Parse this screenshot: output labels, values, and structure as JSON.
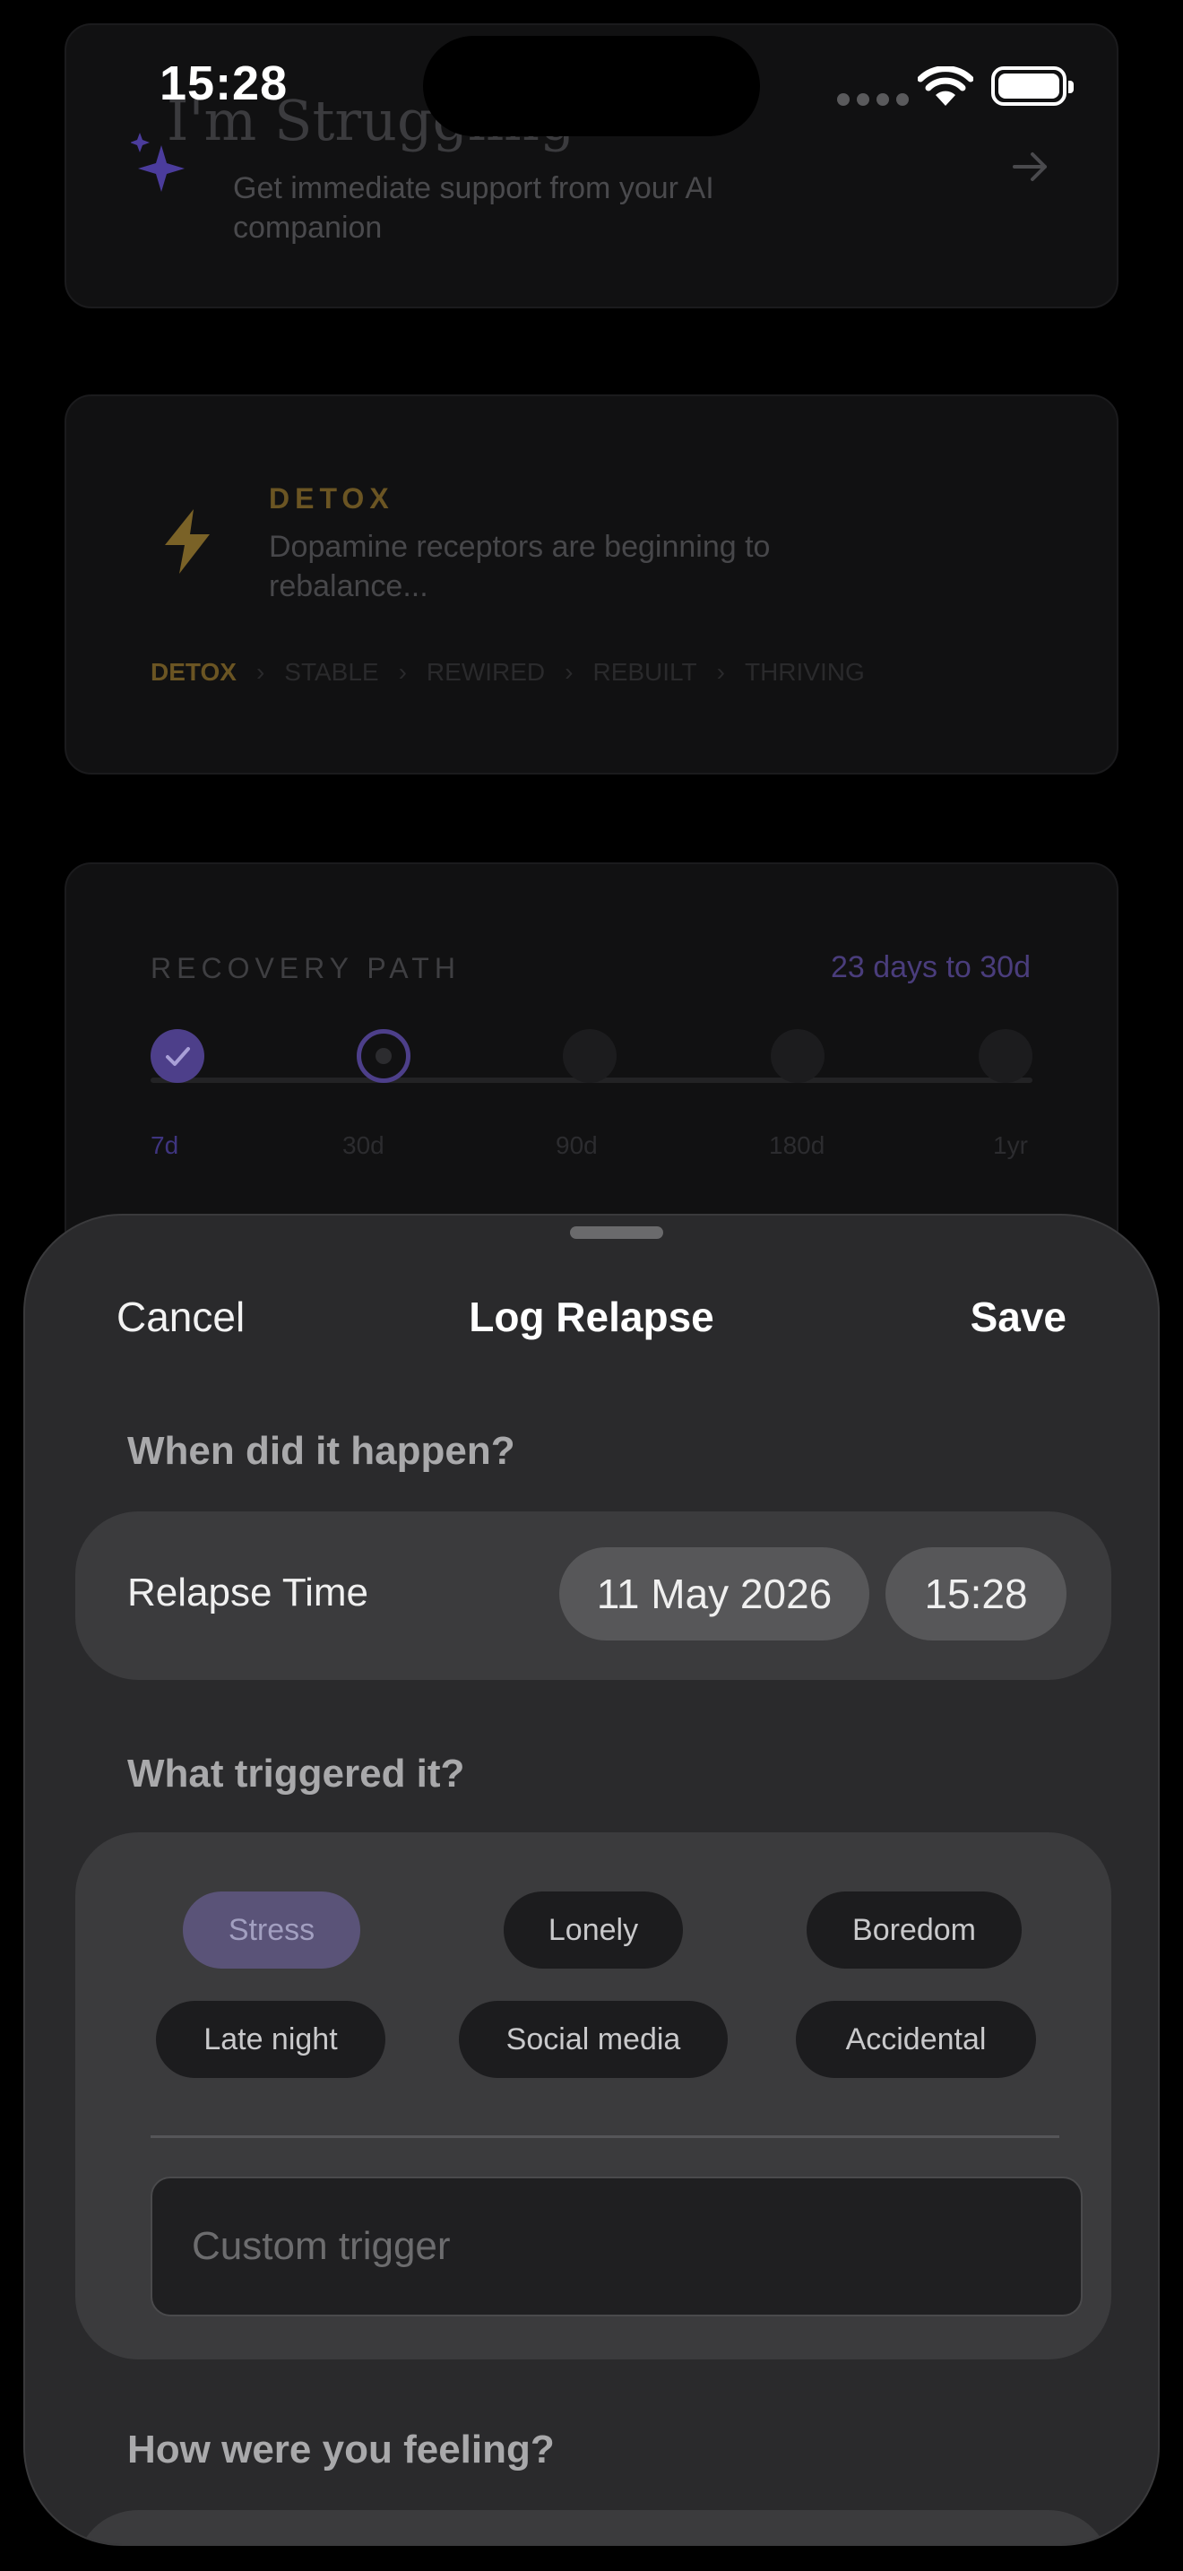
{
  "status_bar": {
    "time": "15:28"
  },
  "support_card": {
    "title": "I'm Struggling",
    "subtitle": "Get immediate support from your AI companion"
  },
  "phase_card": {
    "label": "DETOX",
    "description": "Dopamine receptors are beginning to rebalance...",
    "stages": [
      "DETOX",
      "STABLE",
      "REWIRED",
      "REBUILT",
      "THRIVING"
    ],
    "active_stage": "DETOX"
  },
  "recovery_path": {
    "label": "RECOVERY PATH",
    "days_remaining": "23 days to 30d",
    "milestones": [
      "7d",
      "30d",
      "90d",
      "180d",
      "1yr"
    ]
  },
  "sheet": {
    "cancel": "Cancel",
    "title": "Log Relapse",
    "save": "Save",
    "when_label": "When did it happen?",
    "relapse_time_label": "Relapse Time",
    "date": "11 May 2026",
    "time": "15:28",
    "trigger_label": "What triggered it?",
    "triggers": [
      "Stress",
      "Lonely",
      "Boredom",
      "Late night",
      "Social media",
      "Accidental"
    ],
    "selected_trigger": "Stress",
    "custom_trigger_placeholder": "Custom trigger",
    "feeling_label": "How were you feeling?"
  },
  "colors": {
    "accent_purple": "#7b6ad6",
    "detox_gold": "#c9a13c",
    "sheet_bg": "#2a2a2c"
  }
}
